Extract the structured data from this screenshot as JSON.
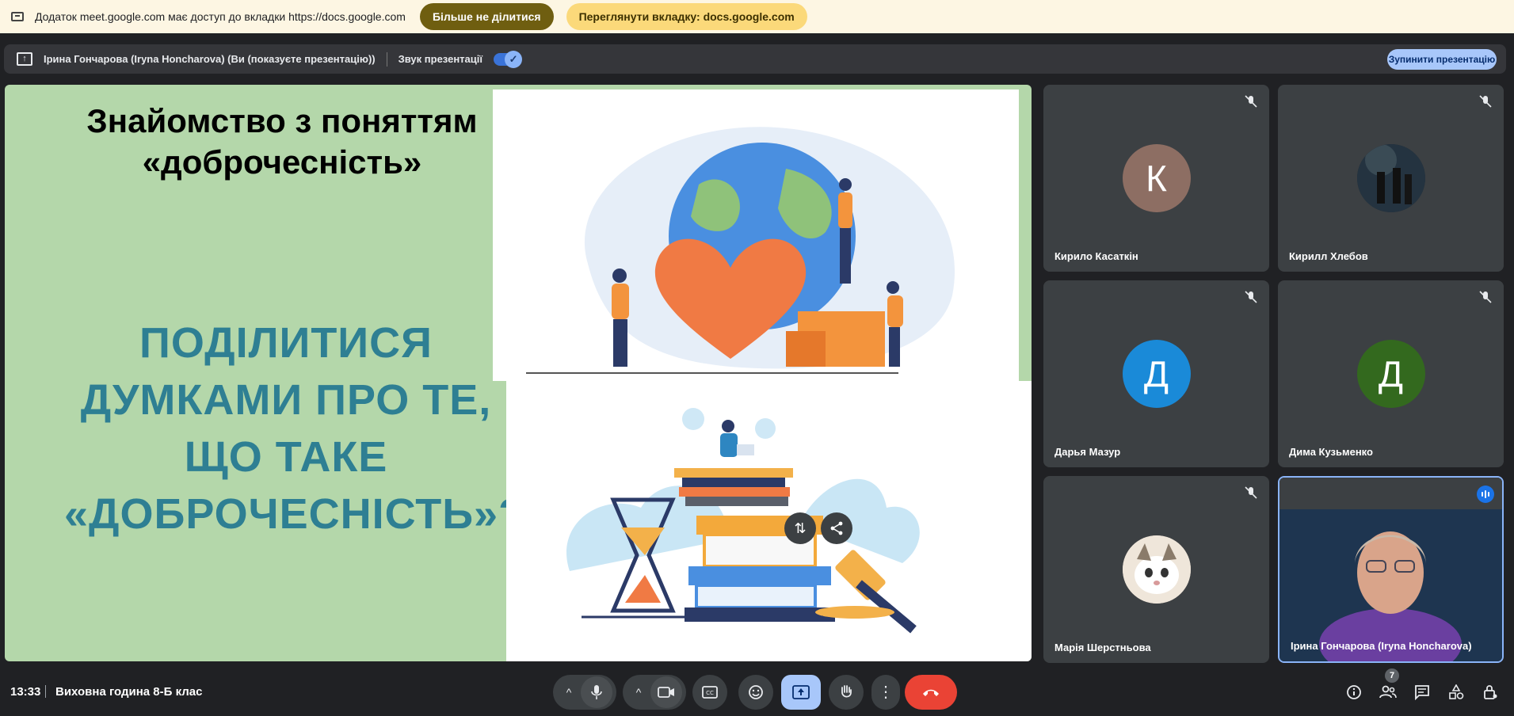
{
  "infobar": {
    "message": "Додаток meet.google.com має доступ до вкладки https://docs.google.com",
    "stop_sharing_label": "Більше не ділитися",
    "view_tab_label": "Переглянути вкладку: docs.google.com"
  },
  "presenting": {
    "text": "Ірина Гончарова (Iryna Honcharova) (Ви (показуєте презентацію))",
    "audio_label": "Звук презентації",
    "audio_on": true,
    "stop_label": "Зупинити презентацію"
  },
  "slide": {
    "title": "Знайомство з поняттям «доброчесність»",
    "question": "ПОДІЛИТИСЯ ДУМКАМИ ПРО ТЕ, ЩО ТАКЕ «ДОБРОЧЕСНІСТЬ»?"
  },
  "participants": [
    {
      "name": "Кирило Касаткін",
      "initial": "К",
      "color": "#8d6e63",
      "muted": true
    },
    {
      "name": "Кирилл Хлебов",
      "initial": "",
      "color": "#1f2a33",
      "muted": true
    },
    {
      "name": "Дарья Мазур",
      "initial": "Д",
      "color": "#1a8ad8",
      "muted": true
    },
    {
      "name": "Дима Кузьменко",
      "initial": "Д",
      "color": "#33691e",
      "muted": true
    },
    {
      "name": "Марія Шерстньова",
      "initial": "",
      "color": "#d8c8b8",
      "muted": true
    },
    {
      "name": "Ірина Гончарова (Iryna Honcharova)",
      "initial": "",
      "color": "#1f3a5a",
      "muted": false
    }
  ],
  "bottom": {
    "time": "13:33",
    "meeting": "Виховна година 8-Б клас",
    "people_count": "7"
  },
  "icons": {
    "mic": "microphone-icon",
    "camera": "camera-icon",
    "captions": "captions-icon",
    "emoji": "emoji-icon",
    "present": "present-icon",
    "hand": "raise-hand-icon",
    "more": "more-icon",
    "end": "end-call-icon"
  },
  "colors": {
    "accent": "#a8c7fa",
    "end_call": "#ea4335",
    "slide_bg": "#b4d7aa",
    "question_text": "#2e7f93"
  }
}
